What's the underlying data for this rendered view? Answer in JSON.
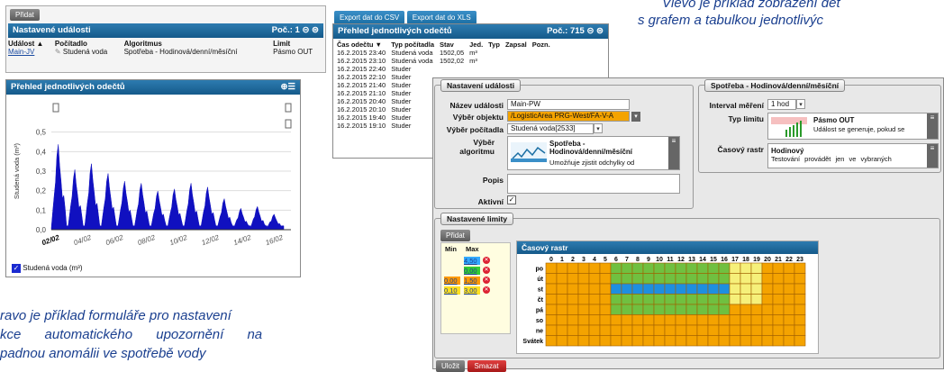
{
  "captions": {
    "top_right_line1": "Vlevo je příklad zobrazení det",
    "top_right_line2": "s grafem a tabulkou jednotlivýc",
    "bottom_left_line1": "ravo je příklad formuláře pro nastavení",
    "bottom_left_line2": "kce automatického upozornění na",
    "bottom_left_line3": "padnou anomálii ve spotřebě vody"
  },
  "events_panel": {
    "add_button": "Přidat",
    "title": "Nastavené události",
    "count_label": "Poč.: 1",
    "columns": [
      "Událost ▲",
      "Počítadlo",
      "Algoritmus",
      "Limit"
    ],
    "row": {
      "event": "Main-JV",
      "counter": "Studená voda",
      "algorithm": "Spotřeba - Hodinová/denní/měsíční",
      "limit": "Pásmo OUT"
    }
  },
  "readings_panel": {
    "export_csv": "Export dat do CSV",
    "export_xls": "Export dat do XLS",
    "title": "Přehled jednotlivých odečtů",
    "count_label": "Poč.: 715",
    "columns": [
      "Čas odečtu ▼",
      "Typ počítadla",
      "Stav",
      "Jed.",
      "Typ",
      "Zapsal",
      "Pozn."
    ],
    "rows": [
      [
        "16.2.2015 23:40",
        "Studená voda",
        "1502,05",
        "m³"
      ],
      [
        "16.2.2015 23:10",
        "Studená voda",
        "1502,02",
        "m³"
      ],
      [
        "16.2.2015 22:40",
        "Studer",
        "",
        ""
      ],
      [
        "16.2.2015 22:10",
        "Studer",
        "",
        ""
      ],
      [
        "16.2.2015 21:40",
        "Studer",
        "",
        ""
      ],
      [
        "16.2.2015 21:10",
        "Studer",
        "",
        ""
      ],
      [
        "16.2.2015 20:40",
        "Studer",
        "",
        ""
      ],
      [
        "16.2.2015 20:10",
        "Studer",
        "",
        ""
      ],
      [
        "16.2.2015 19:40",
        "Studer",
        "",
        ""
      ],
      [
        "16.2.2015 19:10",
        "Studer",
        "",
        ""
      ]
    ]
  },
  "chart_panel": {
    "title": "Přehled jednotlivých odečtů",
    "legend": "Studená voda (m³)"
  },
  "chart_data": {
    "type": "area",
    "title": "",
    "xlabel": "",
    "ylabel": "Studená voda (m³)",
    "ylim": [
      0,
      0.6
    ],
    "y_ticks": [
      "0,0",
      "0,1",
      "0,2",
      "0,3",
      "0,4",
      "0,5"
    ],
    "x_ticks": [
      "02/02",
      "04/02",
      "06/02",
      "08/02",
      "10/02",
      "12/02",
      "14/02",
      "16/02"
    ],
    "series": [
      {
        "name": "Studená voda (m³)",
        "color": "#1010c0",
        "peaks": [
          0.44,
          0.31,
          0.34,
          0.29,
          0.25,
          0.24,
          0.2,
          0.21,
          0.24,
          0.22,
          0.16,
          0.11,
          0.12,
          0.08
        ]
      }
    ]
  },
  "event_settings": {
    "title": "Nastavení události",
    "fields": {
      "name_label": "Název události",
      "name_value": "Main-PW",
      "object_label": "Výběr objektu",
      "object_value": "/LogisticArea PRG-West/FA-V-A",
      "counter_label": "Výběr počítadla",
      "counter_value": "Studená voda[2533]",
      "algorithm_label": "Výběr algoritmu",
      "algorithm_name": "Spotřeba - Hodinová/denní/měsíční",
      "algorithm_desc": "Umožňuje zjistit odchylky od",
      "description_label": "Popis",
      "active_label": "Aktivní"
    }
  },
  "algo_settings": {
    "title": "Spotřeba - Hodinová/denní/měsíční",
    "interval_label": "Interval měření",
    "interval_value": "1 hod",
    "limit_type_label": "Typ limitu",
    "limit_type_name": "Pásmo OUT",
    "limit_type_desc": "Událost se generuje, pokud se",
    "raster_label": "Časový rastr",
    "raster_name": "Hodinový",
    "raster_desc": "Testování provádět jen ve vybraných"
  },
  "limits_panel": {
    "title": "Nastavené limity",
    "add_button": "Přidat",
    "min_label": "Min",
    "max_label": "Max",
    "limit_rows": [
      {
        "min": "",
        "max": "4,50",
        "color": "#33aaff"
      },
      {
        "min": "",
        "max": "0,00",
        "color": "#33cc33"
      },
      {
        "min": "0,00",
        "max": "1,50",
        "color": "#ff9900"
      },
      {
        "min": "0,10",
        "max": "3,00",
        "color": "#ffe020"
      }
    ],
    "grid_title": "Časový rastr",
    "hours": [
      "0",
      "1",
      "2",
      "3",
      "4",
      "5",
      "6",
      "7",
      "8",
      "9",
      "10",
      "11",
      "12",
      "13",
      "14",
      "15",
      "16",
      "17",
      "18",
      "19",
      "20",
      "21",
      "22",
      "23"
    ],
    "days": [
      "po",
      "út",
      "st",
      "čt",
      "pá",
      "so",
      "ne",
      "Svátek"
    ],
    "colors": {
      "orange": "#f4a300",
      "green": "#70c040",
      "blue": "#1e8fe0",
      "yellow": "#f6f07a"
    }
  },
  "footer": {
    "save": "Uložit",
    "cancel": "Smazat"
  }
}
